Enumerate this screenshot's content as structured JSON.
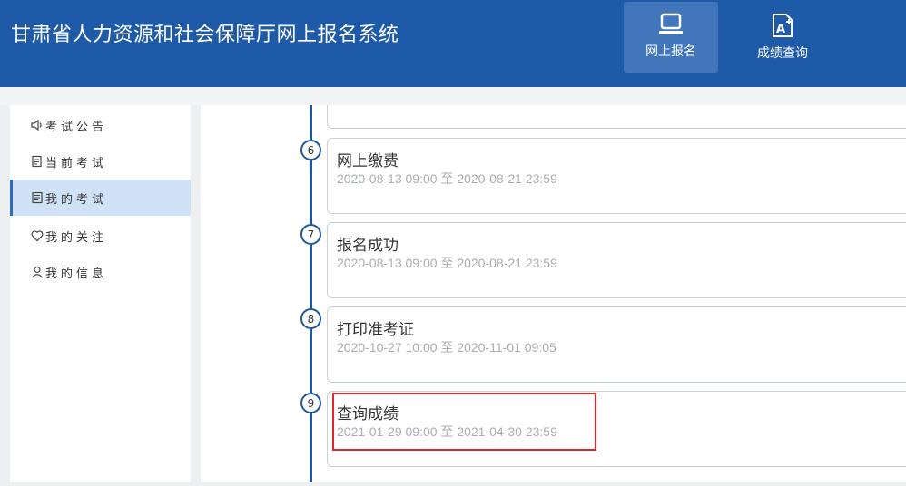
{
  "header": {
    "title": "甘肃省人力资源和社会保障厅网上报名系统",
    "nav": [
      {
        "label": "网上报名",
        "icon": "laptop-icon",
        "active": true
      },
      {
        "label": "成绩查询",
        "icon": "score-document-icon",
        "active": false
      }
    ]
  },
  "sidebar": {
    "items": [
      {
        "label": "考试公告",
        "icon": "speaker-icon"
      },
      {
        "label": "当前考试",
        "icon": "edit-document-icon"
      },
      {
        "label": "我的考试",
        "icon": "exam-document-icon",
        "active": true
      },
      {
        "label": "我的关注",
        "icon": "heart-icon"
      },
      {
        "label": "我的信息",
        "icon": "user-icon"
      }
    ]
  },
  "steps": [
    {
      "number": "6",
      "title": "网上缴费",
      "range": "2020-08-13 09:00 至 2020-08-21 23:59"
    },
    {
      "number": "7",
      "title": "报名成功",
      "range": "2020-08-13 09:00 至 2020-08-21 23:59"
    },
    {
      "number": "8",
      "title": "打印准考证",
      "range": "2020-10-27 10.00 至 2020-11-01 09:05"
    },
    {
      "number": "9",
      "title": "查询成绩",
      "range": "2021-01-29 09:00 至 2021-04-30 23:59"
    }
  ],
  "colors": {
    "header_bg": "#1f5aa8",
    "active_nav_bg": "#4176bb",
    "timeline": "#20579a",
    "sidebar_active": "#cfe2f7",
    "highlight": "#e0262a"
  }
}
